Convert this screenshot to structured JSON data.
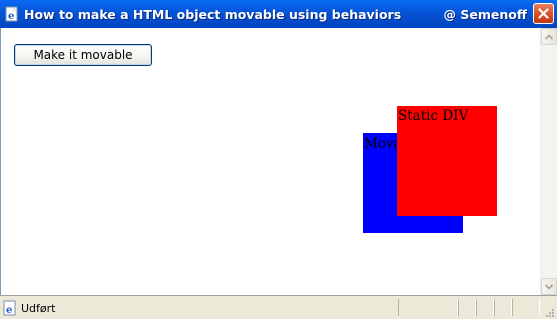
{
  "window": {
    "title": "How to make a HTML object movable using behaviors",
    "title_right": "@ Semenoff",
    "app_icon": "ie-page-icon",
    "close_icon": "close-icon"
  },
  "content": {
    "make_movable_button": "Make it movable",
    "movable_div_label": "Movable DIV",
    "static_div_label": "Static DIV",
    "colors": {
      "movable_div": "#0000ff",
      "static_div": "#ff0000"
    }
  },
  "statusbar": {
    "text": "Udført",
    "icon": "ie-page-icon"
  }
}
